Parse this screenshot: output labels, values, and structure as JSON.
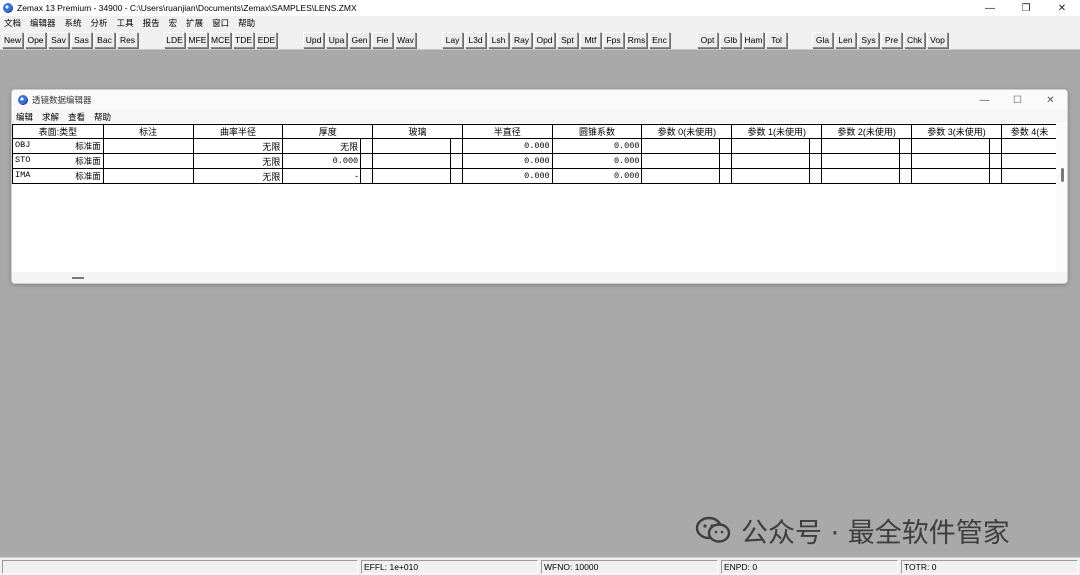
{
  "window": {
    "title": "Zemax 13 Premium - 34900 - C:\\Users\\ruanjian\\Documents\\Zemax\\SAMPLES\\LENS.ZMX"
  },
  "menu": [
    "文档",
    "编辑器",
    "系统",
    "分析",
    "工具",
    "报告",
    "宏",
    "扩展",
    "窗口",
    "帮助"
  ],
  "toolbar": [
    "New",
    "Ope",
    "Sav",
    "Sas",
    "Bac",
    "Res",
    "LDE",
    "MFE",
    "MCE",
    "TDE",
    "EDE",
    "Upd",
    "Upa",
    "Gen",
    "Fie",
    "Wav",
    "Lay",
    "L3d",
    "Lsh",
    "Ray",
    "Opd",
    "Spt",
    "Mtf",
    "Fps",
    "Rms",
    "Enc",
    "Opt",
    "Glb",
    "Ham",
    "Tol",
    "Gla",
    "Len",
    "Sys",
    "Pre",
    "Chk",
    "Vop"
  ],
  "editor": {
    "title": "透镜数据编辑器",
    "menu": [
      "编辑",
      "求解",
      "查看",
      "帮助"
    ],
    "columns": [
      "表面:类型",
      "标注",
      "曲率半径",
      "厚度",
      "玻璃",
      "半直径",
      "圆锥系数",
      "参数 0(未使用)",
      "参数 1(未使用)",
      "参数 2(未使用)",
      "参数 3(未使用)",
      "参数 4(未"
    ],
    "rows": [
      {
        "id": "OBJ",
        "type": "标准面",
        "comment": "",
        "radius": "无限",
        "thickness": "无限",
        "glass": "",
        "semi": "0.000",
        "conic": "0.000"
      },
      {
        "id": "STO",
        "type": "标准面",
        "comment": "",
        "radius": "无限",
        "thickness": "0.000",
        "glass": "",
        "semi": "0.000",
        "conic": "0.000"
      },
      {
        "id": "IMA",
        "type": "标准面",
        "comment": "",
        "radius": "无限",
        "thickness": "-",
        "glass": "",
        "semi": "0.000",
        "conic": "0.000"
      }
    ]
  },
  "watermark": "公众号 · 最全软件管家",
  "status": {
    "effl": "EFFL: 1e+010",
    "wfno": "WFNO: 10000",
    "enpd": "ENPD: 0",
    "totr": "TOTR: 0"
  }
}
